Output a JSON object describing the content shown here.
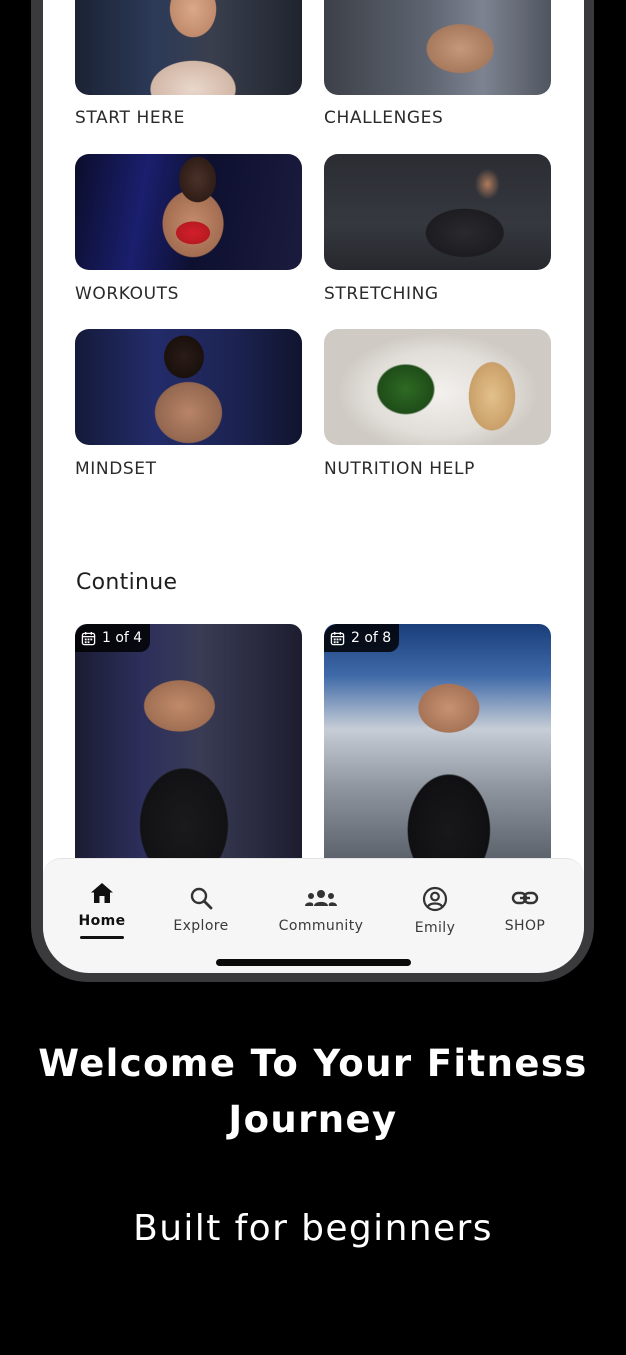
{
  "categories": [
    {
      "label": "START HERE",
      "image": "woman-smiling-gym-photo"
    },
    {
      "label": "CHALLENGES",
      "image": "woman-cycling-gym-photo"
    },
    {
      "label": "WORKOUTS",
      "image": "woman-dumbbell-press-photo"
    },
    {
      "label": "STRETCHING",
      "image": "woman-lunge-stretch-photo"
    },
    {
      "label": "MINDSET",
      "image": "woman-resting-bench-photo"
    },
    {
      "label": "NUTRITION HELP",
      "image": "chicken-vegetables-plate-photo"
    }
  ],
  "continue_section": {
    "title": "Continue",
    "items": [
      {
        "progress": "1 of 4",
        "icon": "calendar-icon",
        "image": "woman-back-workout-photo"
      },
      {
        "progress": "2 of 8",
        "icon": "calendar-icon",
        "image": "woman-back-gym-photo"
      }
    ]
  },
  "tab_bar": {
    "active": "Home",
    "tabs": [
      {
        "label": "Home",
        "icon": "home-icon"
      },
      {
        "label": "Explore",
        "icon": "search-icon"
      },
      {
        "label": "Community",
        "icon": "community-icon"
      },
      {
        "label": "Emily",
        "icon": "profile-icon"
      },
      {
        "label": "SHOP",
        "icon": "link-icon"
      }
    ]
  },
  "promo": {
    "title_line1": "Welcome To Your Fitness",
    "title_line2": "Journey",
    "subtitle": "Built for beginners"
  },
  "colors": {
    "background": "#000000",
    "screen": "#ffffff",
    "bezel": "#3a3a3c",
    "tab_bar": "#f6f6f6",
    "text_primary": "#1e1e1e"
  }
}
